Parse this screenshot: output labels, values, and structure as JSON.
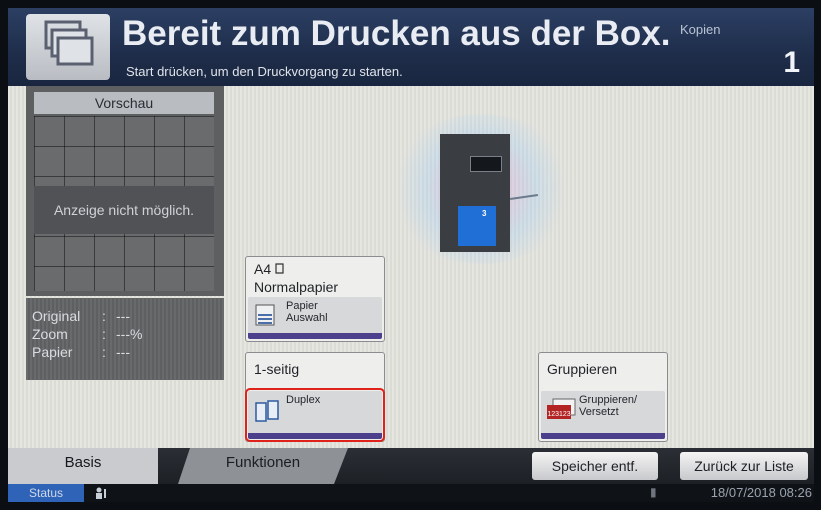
{
  "header": {
    "title": "Bereit zum Drucken aus der Box.",
    "subtitle": "Start drücken, um den Druckvorgang zu starten.",
    "copies_label": "Kopien",
    "copies_value": "1"
  },
  "preview": {
    "title": "Vorschau",
    "message": "Anzeige nicht möglich."
  },
  "info": {
    "rows": [
      {
        "label": "Original",
        "value": "---"
      },
      {
        "label": "Zoom",
        "value": "---%"
      },
      {
        "label": "Papier",
        "value": "---"
      }
    ]
  },
  "printer": {
    "tray_number": "3"
  },
  "paper": {
    "size": "A4",
    "type": "Normalpapier",
    "button": "Papier\nAuswahl"
  },
  "duplex": {
    "label": "1-seitig",
    "button": "Duplex"
  },
  "collate": {
    "label": "Gruppieren",
    "button": "Gruppieren/\nVersetzt",
    "icon_text": "123123"
  },
  "tabs": {
    "basis": "Basis",
    "funktionen": "Funktionen"
  },
  "actions": {
    "delete": "Speicher entf.",
    "back": "Zurück zur Liste"
  },
  "status": {
    "label": "Status",
    "datetime": "18/07/2018 08:26"
  }
}
